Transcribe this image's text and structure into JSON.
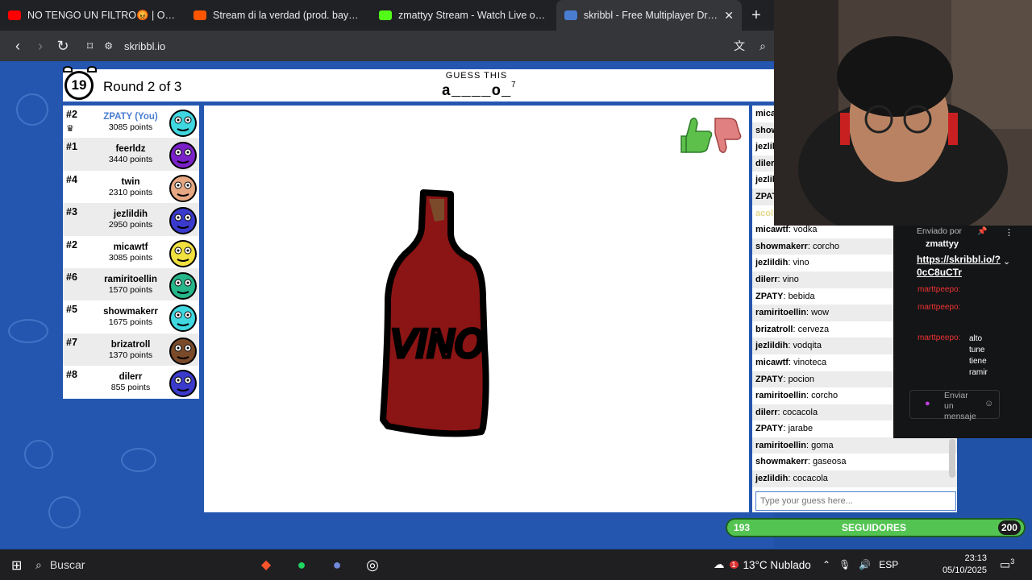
{
  "browser": {
    "tabs": [
      {
        "title": "NO TENGO UN FILTRO😡 | OMETV -",
        "favicon_color": "#ff0000",
        "active": false
      },
      {
        "title": "Stream di la verdad (prod. bayergartr",
        "favicon_color": "#ff5500",
        "active": false
      },
      {
        "title": "zmattyy Stream - Watch Live on Kick",
        "favicon_color": "#53fc18",
        "active": false
      },
      {
        "title": "skribbl - Free Multiplayer Drawin",
        "favicon_color": "#4a7dd0",
        "active": true
      }
    ],
    "url": "skribbl.io"
  },
  "game": {
    "timer": "19",
    "round": "Round 2 of 3",
    "guess_label": "GUESS THIS",
    "word_hint": "a____o_",
    "word_length": "7",
    "players": [
      {
        "rank": "#2",
        "name": "ZPATY (You)",
        "points": "3085 points",
        "you": true,
        "color": "#3fd7e0"
      },
      {
        "rank": "#1",
        "name": "feerldz",
        "points": "3440 points",
        "you": false,
        "color": "#7a22c8"
      },
      {
        "rank": "#4",
        "name": "twin",
        "points": "2310 points",
        "you": false,
        "color": "#e6a783"
      },
      {
        "rank": "#3",
        "name": "jezlildih",
        "points": "2950 points",
        "you": false,
        "color": "#3a3acc"
      },
      {
        "rank": "#2",
        "name": "micawtf",
        "points": "3085 points",
        "you": false,
        "color": "#f0e040"
      },
      {
        "rank": "#6",
        "name": "ramiritoellin",
        "points": "1570 points",
        "you": false,
        "color": "#27b58a"
      },
      {
        "rank": "#5",
        "name": "showmakerr",
        "points": "1675 points",
        "you": false,
        "color": "#3fd7e0"
      },
      {
        "rank": "#7",
        "name": "brizatroll",
        "points": "1370 points",
        "you": false,
        "color": "#7a4a2a"
      },
      {
        "rank": "#8",
        "name": "dilerr",
        "points": "855 points",
        "you": false,
        "color": "#3a3acc"
      }
    ],
    "bubbles": [
      "cocacola",
      "gaseosa"
    ],
    "chat_partial": [
      "mica",
      "show",
      "jezlil",
      "diler",
      "jezlil",
      "ZPAT",
      "acol"
    ],
    "chat": [
      {
        "user": "micawtf",
        "text": "vodka"
      },
      {
        "user": "showmakerr",
        "text": "corcho"
      },
      {
        "user": "jezlildih",
        "text": "vino"
      },
      {
        "user": "dilerr",
        "text": "vino"
      },
      {
        "user": "ZPATY",
        "text": "bebida"
      },
      {
        "user": "ramiritoellin",
        "text": "wow"
      },
      {
        "user": "brizatroll",
        "text": "cerveza"
      },
      {
        "user": "jezlildih",
        "text": "vodqita"
      },
      {
        "user": "micawtf",
        "text": "vinoteca"
      },
      {
        "user": "ZPATY",
        "text": "pocion"
      },
      {
        "user": "ramiritoellin",
        "text": "corcho"
      },
      {
        "user": "dilerr",
        "text": "cocacola"
      },
      {
        "user": "ZPATY",
        "text": "jarabe"
      },
      {
        "user": "ramiritoellin",
        "text": "goma"
      },
      {
        "user": "showmakerr",
        "text": "gaseosa"
      },
      {
        "user": "jezlildih",
        "text": "cocacola"
      }
    ],
    "guess_placeholder": "Type your guess here...",
    "drawing_text": "VINO"
  },
  "stream_overlay": {
    "pinned_by": "Enviado por",
    "pinned_user": "zmattyy",
    "pinned_link": "https://skribbl.io/?0cC8uCTr",
    "chat_user": "marttpeepo:",
    "chat_text": "alto tune tiene ramir",
    "send_placeholder": "Enviar un mensaje",
    "followers_current": "193",
    "followers_label": "SEGUIDORES",
    "followers_goal": "200",
    "followers_progress": 0.965
  },
  "taskbar": {
    "search": "Buscar",
    "weather": "13°C Nublado",
    "weather_badge": "1",
    "lang": "ESP",
    "time": "23:13",
    "date": "05/10/2025",
    "notifications": "3"
  }
}
